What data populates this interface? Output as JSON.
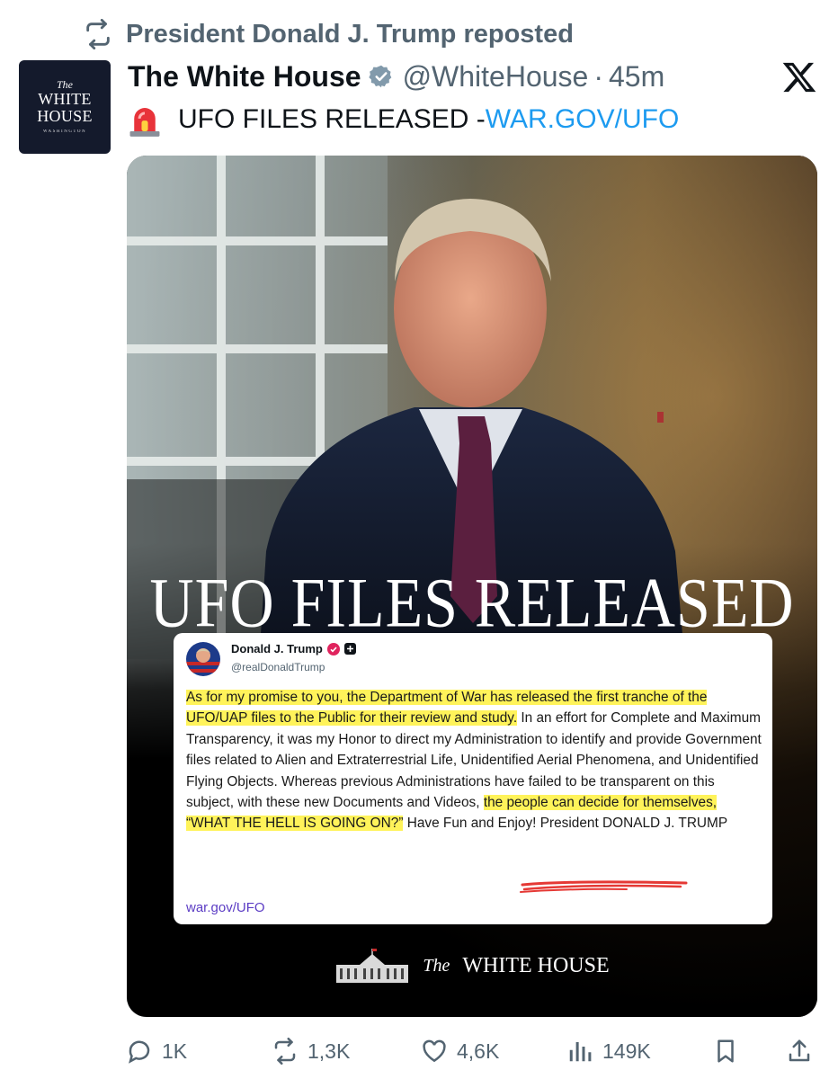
{
  "repost": {
    "label": "President Donald J. Trump reposted",
    "icon": "repost-icon"
  },
  "author": {
    "avatar": {
      "the": "The",
      "line1": "WHITE",
      "line2": "HOUSE",
      "sub": "WASHINGTON"
    },
    "name": "The White House",
    "handle": "@WhiteHouse",
    "separator": "·",
    "time": "45m",
    "verified_color": "#829aab"
  },
  "tweet": {
    "icon": "siren-icon",
    "text": "UFO FILES RELEASED - ",
    "link": "WAR.GOV/UFO",
    "link_color": "#1d9bf0"
  },
  "media": {
    "headline": "UFO FILES RELEASED",
    "card": {
      "name": "Donald J. Trump",
      "handle": "@realDonaldTrump",
      "body_highlight_1": "As for my promise to you, the Department of War has released the first tranche of the UFO/UAP files to the Public for their review and study.",
      "body_text_1": " In an effort for Complete and Maximum Transparency, it was my Honor to direct my Administration to identify and provide Government files related to Alien and Extraterrestrial Life, Unidentified Aerial Phenomena, and Unidentified Flying Objects. Whereas previous Administrations have failed to be transparent on this subject, with these new Documents and Videos, ",
      "body_highlight_2": "the people can decide for themselves, “WHAT THE HELL IS GOING ON?”",
      "body_text_2": " Have Fun and Enjoy! President DONALD J. TRUMP",
      "link": "war.gov/UFO",
      "highlight_color": "#fff35a"
    },
    "footer": {
      "the": "The",
      "name": "WHITE HOUSE"
    }
  },
  "actions": {
    "replies": "1K",
    "reposts": "1,3K",
    "likes": "4,6K",
    "views": "149K"
  }
}
